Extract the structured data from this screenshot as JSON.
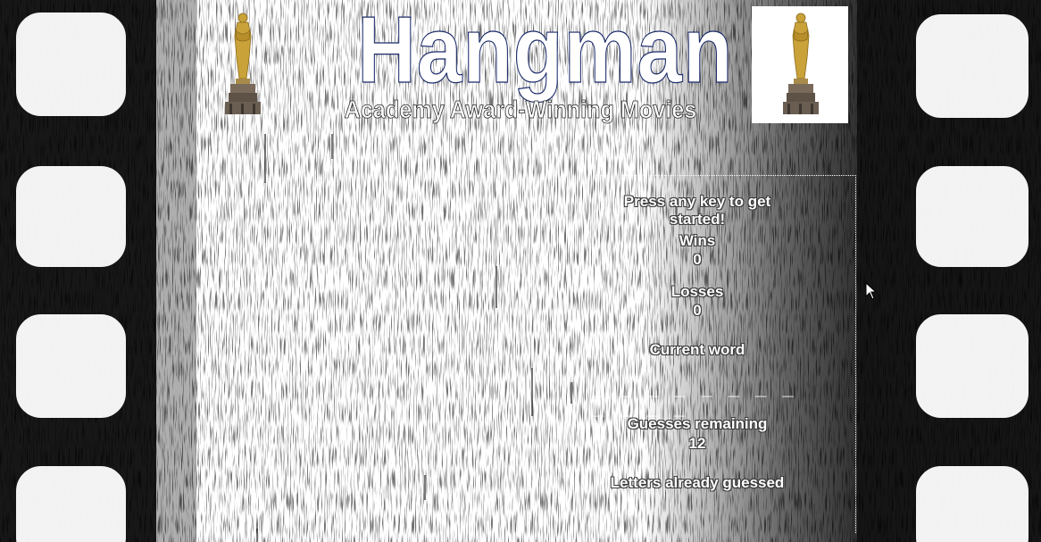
{
  "header": {
    "title": "Hangman",
    "subtitle": "Academy Award-Winning Movies"
  },
  "icons": {
    "left_trophy": "oscar-statuette-icon",
    "right_trophy": "oscar-statuette-icon",
    "cursor": "mouse-pointer-icon"
  },
  "game": {
    "prompt": "Press any key to get started!",
    "wins_label": "Wins",
    "wins_value": "0",
    "losses_label": "Losses",
    "losses_value": "0",
    "current_word_label": "Current word",
    "current_word_display": "_ _ _ _ _ _ _ _ _ _ _ _",
    "guesses_remaining_label": "Guesses remaining",
    "guesses_remaining_value": "12",
    "letters_guessed_label": "Letters already guessed",
    "letters_guessed_value": ""
  },
  "colors": {
    "film": "#141414",
    "sprocket_hole": "#ffffff",
    "title_outline": "#1a2a6a",
    "gold": "#c9a23a"
  }
}
